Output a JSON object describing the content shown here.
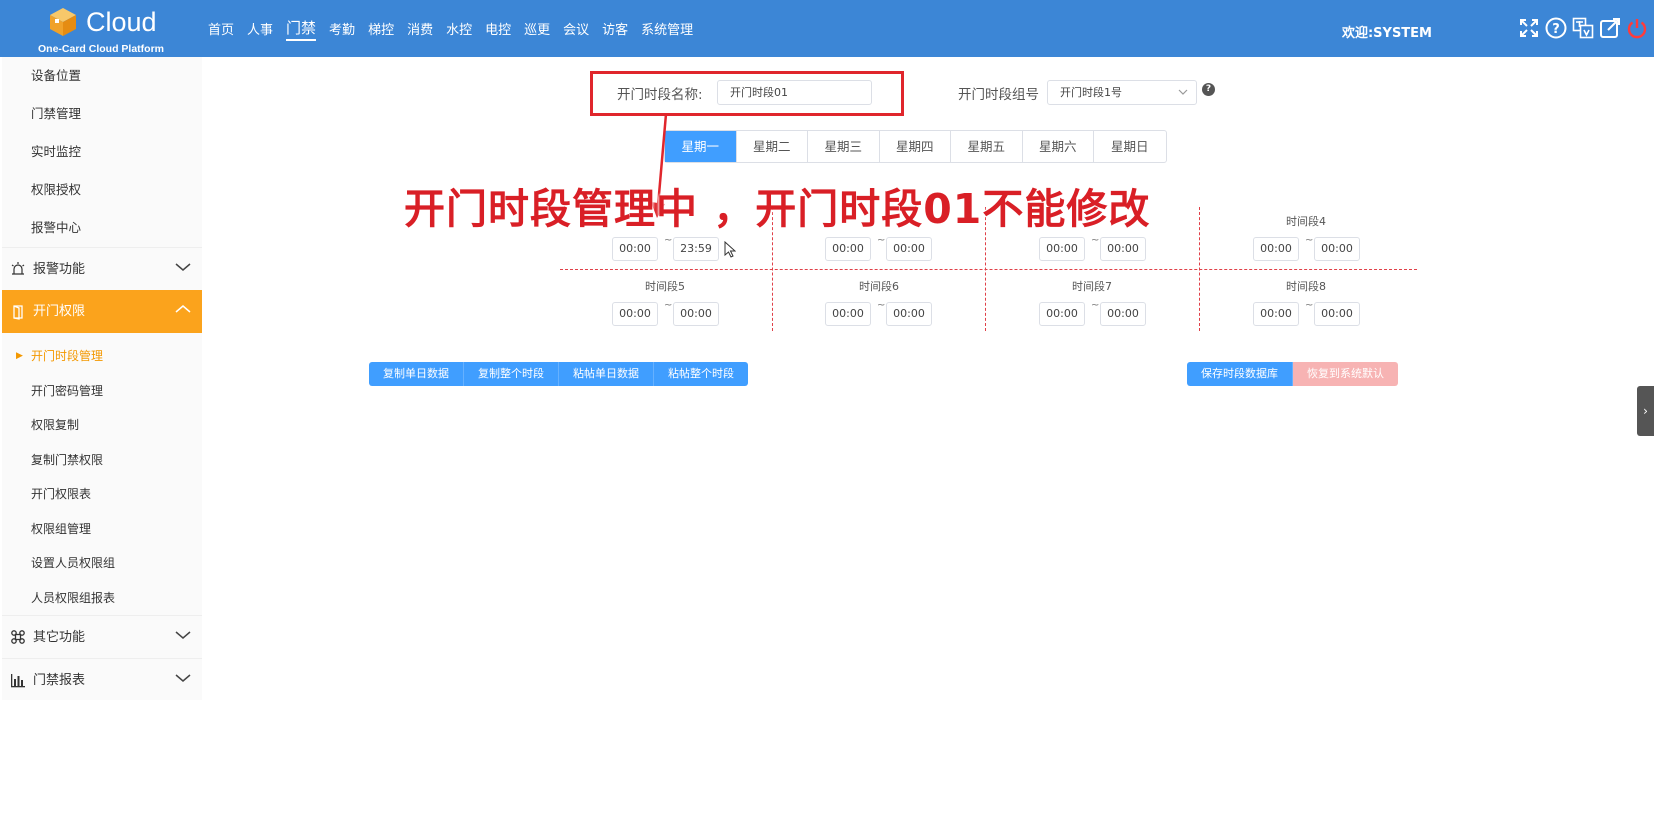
{
  "header": {
    "logo_text": "Cloud",
    "logo_sub": "One-Card Cloud Platform",
    "nav": [
      "首页",
      "人事",
      "门禁",
      "考勤",
      "梯控",
      "消费",
      "水控",
      "电控",
      "巡更",
      "会议",
      "访客",
      "系统管理"
    ],
    "nav_active": "门禁",
    "welcome": "欢迎:SYSTEM",
    "icons": [
      "fullscreen-icon",
      "help-icon",
      "language-icon",
      "external-link-icon",
      "power-icon"
    ]
  },
  "sidebar": {
    "top_items": [
      "设备位置",
      "门禁管理",
      "实时监控",
      "权限授权",
      "报警中心"
    ],
    "group_alarm": "报警功能",
    "group_door": "开门权限",
    "door_items": [
      "开门时段管理",
      "开门密码管理",
      "权限复制",
      "复制门禁权限",
      "开门权限表",
      "权限组管理",
      "设置人员权限组",
      "人员权限组报表"
    ],
    "current_item": "开门时段管理",
    "group_other": "其它功能",
    "group_report": "门禁报表"
  },
  "form": {
    "name_label": "开门时段名称:",
    "name_value": "开门时段01",
    "group_label": "开门时段组号",
    "group_value": "开门时段1号"
  },
  "days": [
    "星期一",
    "星期二",
    "星期三",
    "星期四",
    "星期五",
    "星期六",
    "星期日"
  ],
  "active_day": "星期一",
  "annotation": "开门时段管理中 ，开门时段01不能修改",
  "slots": [
    {
      "title": "",
      "start": "00:00",
      "end": "23:59"
    },
    {
      "title": "",
      "start": "00:00",
      "end": "00:00"
    },
    {
      "title": "",
      "start": "00:00",
      "end": "00:00"
    },
    {
      "title": "时间段4",
      "start": "00:00",
      "end": "00:00"
    },
    {
      "title": "时间段5",
      "start": "00:00",
      "end": "00:00"
    },
    {
      "title": "时间段6",
      "start": "00:00",
      "end": "00:00"
    },
    {
      "title": "时间段7",
      "start": "00:00",
      "end": "00:00"
    },
    {
      "title": "时间段8",
      "start": "00:00",
      "end": "00:00"
    }
  ],
  "slot_separator": "~",
  "left_buttons": [
    "复制单日数据",
    "复制整个时段",
    "粘帖单日数据",
    "粘帖整个时段"
  ],
  "right_buttons": [
    "保存时段数据库",
    "恢复到系统默认"
  ]
}
